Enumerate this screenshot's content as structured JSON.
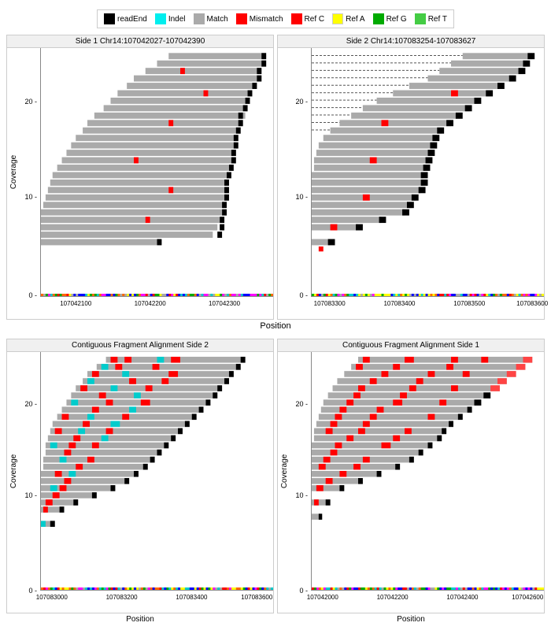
{
  "legend": {
    "items": [
      {
        "label": "readEnd",
        "color": "#000000"
      },
      {
        "label": "Indel",
        "color": "#00FFFF"
      },
      {
        "label": "Match",
        "color": "#AAAAAA"
      },
      {
        "label": "Mismatch",
        "color": "#FF0000"
      },
      {
        "label": "Ref C",
        "color": "#FF0000"
      },
      {
        "label": "Ref A",
        "color": "#FFFF00"
      },
      {
        "label": "Ref G",
        "color": "#00AA00"
      },
      {
        "label": "Ref T",
        "color": "#00CC00"
      }
    ]
  },
  "top_left": {
    "title": "Side 1 Chr14:107042027-107042390",
    "x_ticks": [
      "107042100",
      "107042200",
      "107042300"
    ],
    "y_ticks": [
      "0",
      "10",
      "20"
    ],
    "x_label": "Position"
  },
  "top_right": {
    "title": "Side 2 Chr14:107083254-107083627",
    "x_ticks": [
      "107083300",
      "107083400",
      "107083500",
      "107083600"
    ],
    "y_ticks": [
      "0",
      "10",
      "20"
    ],
    "x_label": "Position"
  },
  "bottom_left": {
    "title": "Contiguous Fragment Alignment Side 2",
    "x_ticks": [
      "107083000",
      "107083200",
      "107083400",
      "107083600"
    ],
    "y_ticks": [
      "0",
      "10",
      "20"
    ],
    "x_label": "Position"
  },
  "bottom_right": {
    "title": "Contiguous Fragment Alignment Side 1",
    "x_ticks": [
      "107042000",
      "107042200",
      "107042400",
      "107042600"
    ],
    "y_ticks": [
      "0",
      "10",
      "20"
    ],
    "x_label": "Position"
  },
  "main_y_label": "Coverage",
  "main_x_label": "Position"
}
